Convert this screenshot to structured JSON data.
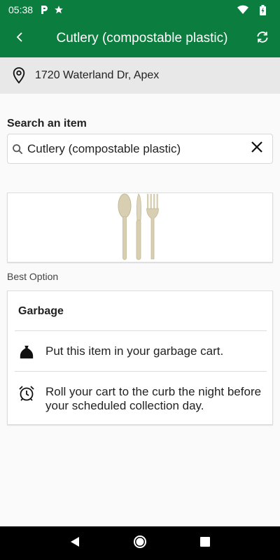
{
  "status_bar": {
    "time": "05:38",
    "icons": [
      "parking-icon",
      "star-icon",
      "wifi-icon",
      "battery-icon"
    ]
  },
  "app_bar": {
    "title": "Cutlery (compostable plastic)",
    "back_icon": "back-chevron-icon",
    "refresh_icon": "refresh-icon",
    "color": "#0b7d3e"
  },
  "location": {
    "address": "1720 Waterland Dr, Apex",
    "icon": "location-pin-icon"
  },
  "search": {
    "label": "Search an item",
    "value": "Cutlery (compostable plastic)",
    "icon": "search-icon",
    "clear_icon": "close-icon"
  },
  "item_image": {
    "icon": "cutlery-image"
  },
  "best_option": {
    "label": "Best Option",
    "heading": "Garbage",
    "instructions": [
      {
        "icon": "garbage-bag-icon",
        "text": "Put this item in your garbage cart."
      },
      {
        "icon": "alarm-clock-icon",
        "text": "Roll your cart to the curb the night before your scheduled collection day."
      }
    ]
  },
  "nav_bar": {
    "icons": [
      "back-triangle-icon",
      "home-circle-icon",
      "recents-square-icon"
    ]
  }
}
